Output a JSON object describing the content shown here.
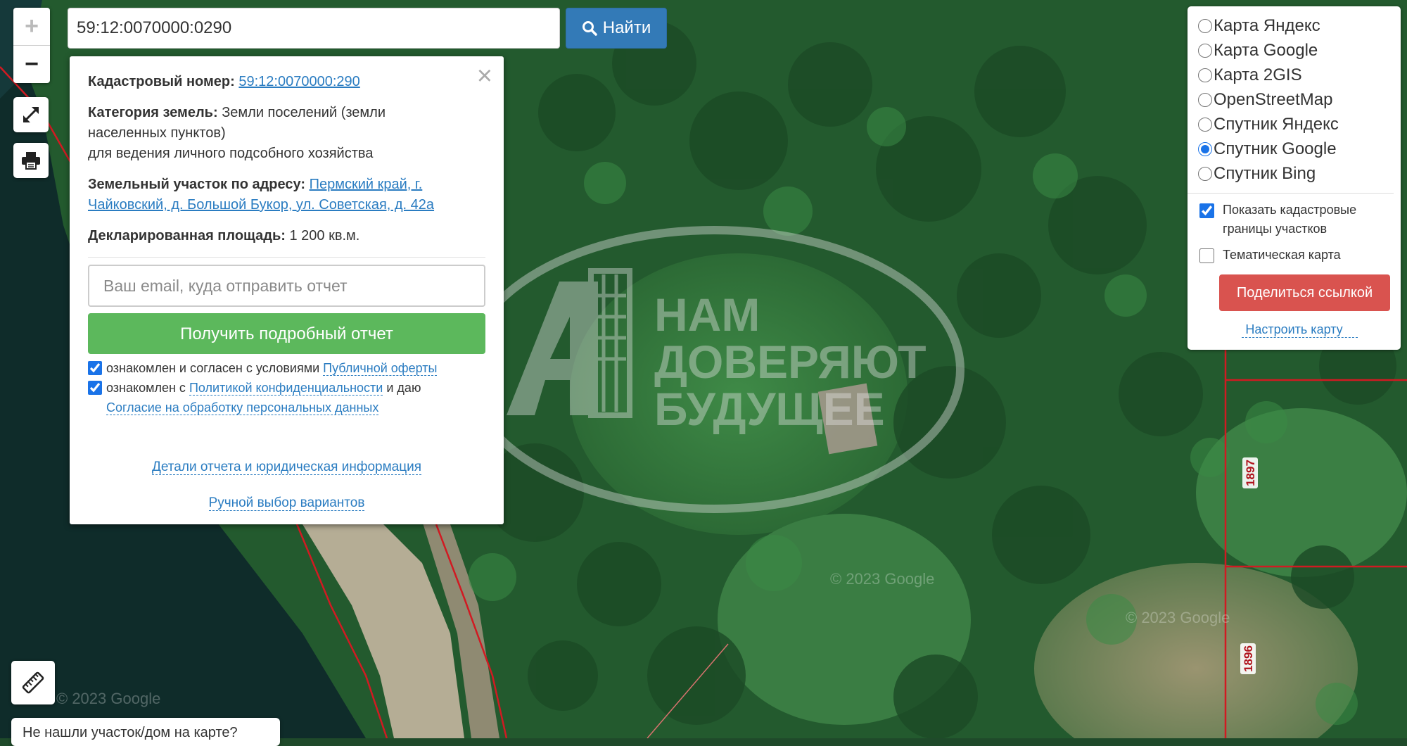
{
  "search": {
    "value": "59:12:0070000:0290",
    "button_label": "Найти"
  },
  "zoom": {
    "in": "+",
    "out": "−"
  },
  "popup": {
    "cadastral_label": "Кадастровый номер:",
    "cadastral_value": "59:12:0070000:290",
    "category_label": "Категория земель:",
    "category_value": "Земли поселений (земли населенных пунктов)",
    "category_use": "для ведения личного подсобного хозяйства",
    "address_label": "Земельный участок по адресу:",
    "address_value": "Пермский край, г. Чайковский, д. Большой Букор, ул. Советская, д. 42а",
    "area_label": "Декларированная площадь:",
    "area_value": "1 200 кв.м.",
    "email_placeholder": "Ваш email, куда отправить отчет",
    "report_button": "Получить подробный отчет",
    "agree1_text": "ознакомлен и согласен с условиями",
    "agree1_link": "Публичной оферты",
    "agree2_text": "ознакомлен с",
    "agree2_link": "Политикой конфиденциальности",
    "agree2_tail": "и даю",
    "agree2_link2": "Согласие на обработку персональных данных",
    "details_link": "Детали отчета и юридическая информация",
    "manual_link": "Ручной выбор вариантов",
    "close": "×"
  },
  "layers": {
    "options": [
      {
        "label": "Карта Яндекс",
        "checked": false
      },
      {
        "label": "Карта Google",
        "checked": false
      },
      {
        "label": "Карта 2GIS",
        "checked": false
      },
      {
        "label": "OpenStreetMap",
        "checked": false
      },
      {
        "label": "Спутник Яндекс",
        "checked": false
      },
      {
        "label": "Спутник Google",
        "checked": true
      },
      {
        "label": "Спутник Bing",
        "checked": false
      }
    ],
    "show_borders": "Показать кадастровые границы участков",
    "thematic": "Тематическая карта",
    "share_button": "Поделиться ссылкой",
    "setup_link": "Настроить карту"
  },
  "map": {
    "watermark_line1": "НАМ",
    "watermark_line2": "ДОВЕРЯЮТ",
    "watermark_line3": "БУДУЩЕЕ",
    "parcel_label1": "1897",
    "parcel_label2": "1896",
    "google_watermark": "© 2023 Google"
  },
  "bottom": {
    "not_found": "Не нашли участок/дом на карте?"
  },
  "colors": {
    "search_button": "#337ab7",
    "report_button": "#5cb85c",
    "share_button": "#d9534f",
    "link": "#2a7cc1",
    "parcel_border": "#d11a22"
  }
}
